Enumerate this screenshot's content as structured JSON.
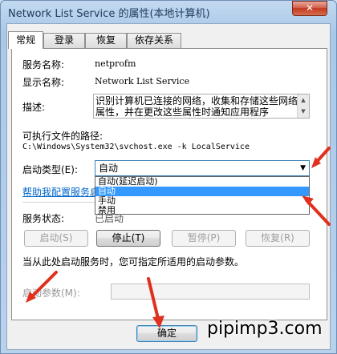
{
  "window": {
    "title": "Network List Service 的属性(本地计算机)",
    "close_label": "✕"
  },
  "tabs": [
    {
      "label": "常规"
    },
    {
      "label": "登录"
    },
    {
      "label": "恢复"
    },
    {
      "label": "依存关系"
    }
  ],
  "general": {
    "service_name_label": "服务名称:",
    "service_name_value": "netprofm",
    "display_name_label": "显示名称:",
    "display_name_value": "Network List Service",
    "description_label": "描述:",
    "description_value": "识别计算机已连接的网络，收集和存储这些网络的属性，并在更改这些属性时通知应用程序",
    "exe_path_label": "可执行文件的路径:",
    "exe_path_value": "C:\\Windows\\System32\\svchost.exe -k LocalService",
    "startup_type_label": "启动类型(E):",
    "startup_type_selected": "自动",
    "startup_options": [
      "自动(延迟启动)",
      "自动",
      "手动",
      "禁用"
    ],
    "help_link": "帮助我配置服务启动",
    "status_label": "服务状态:",
    "status_value": "已启动",
    "start_button": "启动(S)",
    "stop_button": "停止(T)",
    "pause_button": "暂停(P)",
    "resume_button": "恢复(R)",
    "hint_text": "当从此处启动服务时，您可指定所适用的启动参数。",
    "start_params_label": "启动参数(M):",
    "start_params_value": ""
  },
  "footer": {
    "ok_button": "确定"
  },
  "watermark": "pipimp3.com",
  "colors": {
    "accent": "#3399ff",
    "link": "#0066cc",
    "annotation_arrow": "#e0301e"
  }
}
